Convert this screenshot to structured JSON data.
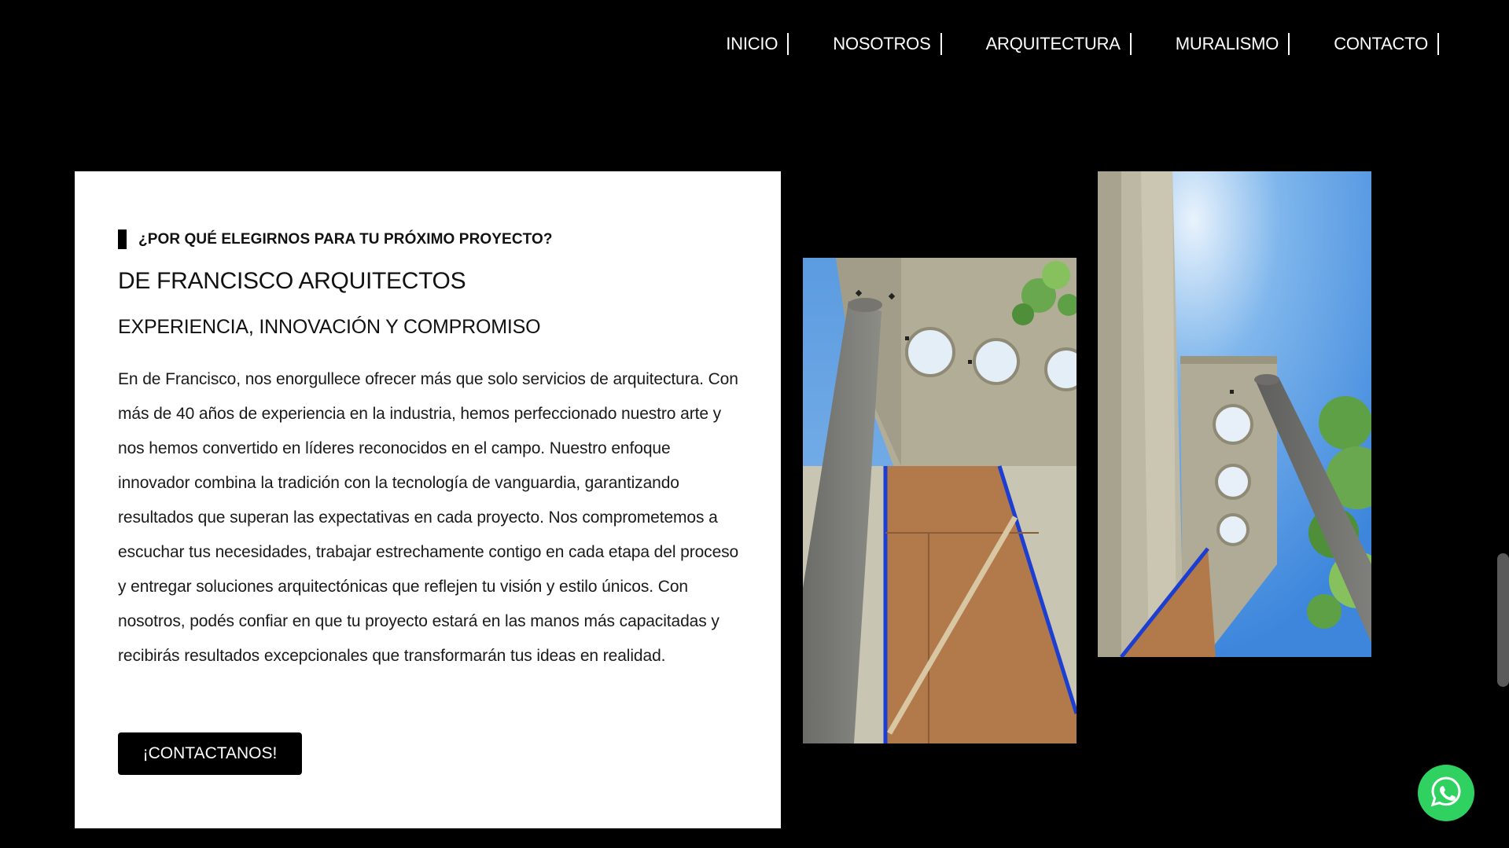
{
  "nav": {
    "items": [
      {
        "label": "INICIO"
      },
      {
        "label": "NOSOTROS"
      },
      {
        "label": "ARQUITECTURA"
      },
      {
        "label": "MURALISMO"
      },
      {
        "label": "CONTACTO"
      }
    ]
  },
  "section": {
    "eyebrow": "¿POR QUÉ ELEGIRNOS PARA TU PRÓXIMO PROYECTO?",
    "title": "DE FRANCISCO ARQUITECTOS",
    "subtitle": "EXPERIENCIA, INNOVACIÓN Y COMPROMISO",
    "body": "En de Francisco, nos enorgullece ofrecer más que solo servicios de arquitectura. Con más de 40 años de experiencia en la industria, hemos perfeccionado nuestro arte y nos hemos convertido en líderes reconocidos en el campo. Nuestro enfoque innovador combina la tradición con la tecnología de vanguardia, garantizando resultados que superan las expectativas en cada proyecto. Nos comprometemos a escuchar tus necesidades, trabajar estrechamente contigo en cada etapa del proceso y entregar soluciones arquitectónicas que reflejen tu visión y estilo únicos. Con nosotros, podés confiar en que tu proyecto estará en las manos más capacitadas y recibirás resultados excepcionales que transformarán tus ideas en realidad.",
    "cta_label": "¡CONTACTANOS!"
  },
  "icons": {
    "whatsapp": "whatsapp-icon"
  },
  "colors": {
    "background": "#000000",
    "card": "#ffffff",
    "text": "#111111",
    "whatsapp": "#2fd160",
    "sky": "#4a90d9"
  }
}
